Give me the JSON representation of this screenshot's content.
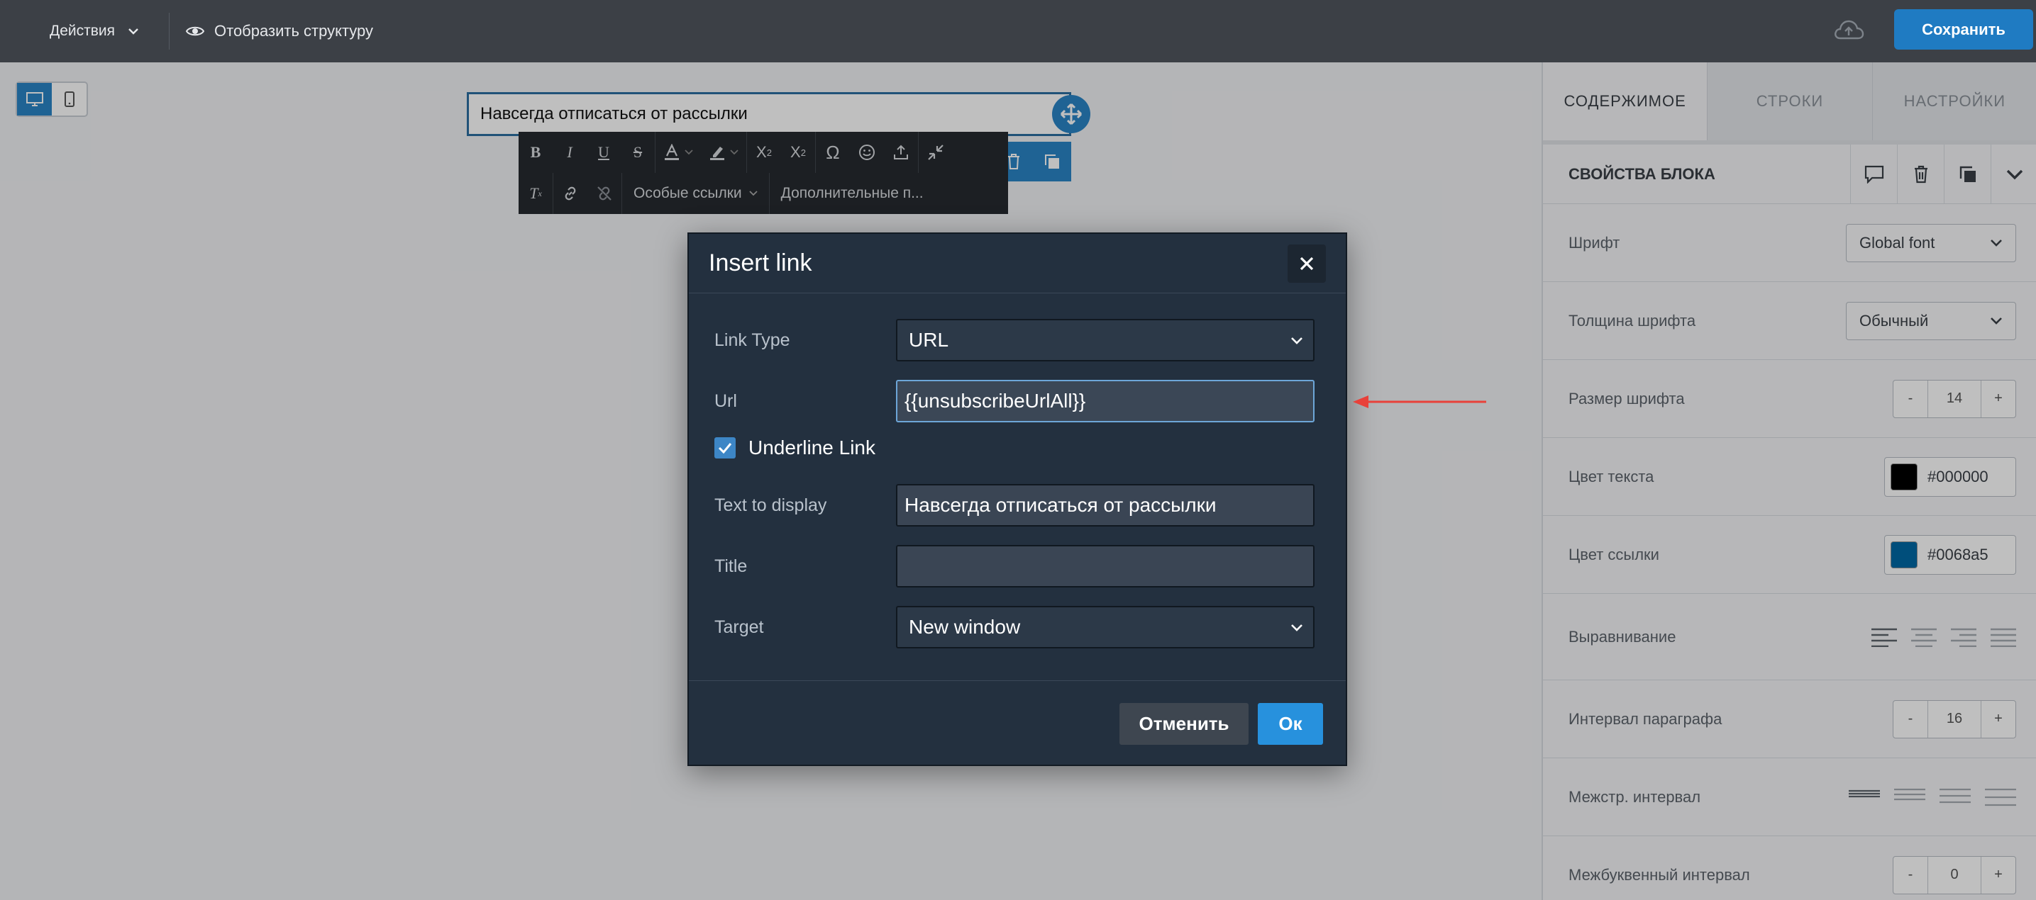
{
  "topbar": {
    "actions_label": "Действия",
    "structure_label": "Отобразить структуру",
    "save_label": "Сохранить"
  },
  "canvas": {
    "text_block": "Навсегда отписаться от рассылки"
  },
  "editor_toolbar": {
    "special_links": "Особые ссылки",
    "extra_params": "Дополнительные п..."
  },
  "right_panel": {
    "tabs": [
      "СОДЕРЖИМОЕ",
      "СТРОКИ",
      "НАСТРОЙКИ"
    ],
    "block_props_title": "СВОЙСТВА БЛОКА",
    "font_label": "Шрифт",
    "font_value": "Global font",
    "weight_label": "Толщина шрифта",
    "weight_value": "Обычный",
    "size_label": "Размер шрифта",
    "size_value": "14",
    "text_color_label": "Цвет текста",
    "text_color_value": "#000000",
    "link_color_label": "Цвет ссылки",
    "link_color_value": "#0068a5",
    "align_label": "Выравнивание",
    "para_label": "Интервал параграфа",
    "para_value": "16",
    "line_label": "Межстр. интервал",
    "letter_label": "Межбуквенный интервал",
    "letter_value": "0",
    "minus": "-",
    "plus": "+"
  },
  "dialog": {
    "title": "Insert link",
    "link_type_label": "Link Type",
    "link_type_value": "URL",
    "url_label": "Url",
    "url_value": "{{unsubscribeUrlAll}}",
    "underline_label": "Underline Link",
    "text_label": "Text to display",
    "text_value": "Навсегда отписаться от рассылки",
    "title_label": "Title",
    "title_value": "",
    "target_label": "Target",
    "target_value": "New window",
    "cancel": "Отменить",
    "ok": "Ок"
  },
  "colors": {
    "accent": "#2a84c6",
    "dialog_bg": "#23303f",
    "annotation_arrow": "#e8413a"
  }
}
